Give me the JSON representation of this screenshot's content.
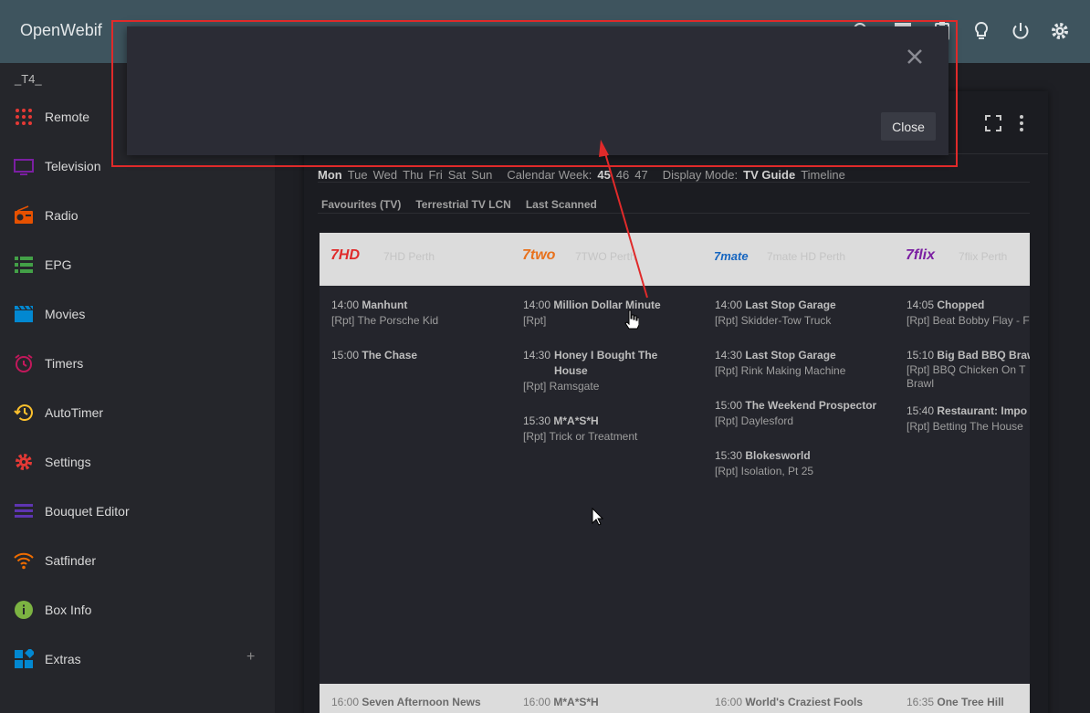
{
  "app": {
    "title": "OpenWebif"
  },
  "topbar": {
    "icons": [
      "search-icon",
      "grid-icon",
      "clipboard-icon",
      "lightbulb-icon",
      "power-icon",
      "gear-icon"
    ]
  },
  "sidebar": {
    "box_name": "_T4_",
    "items": [
      {
        "label": "Remote",
        "icon": "remote-icon",
        "color": "#e53935"
      },
      {
        "label": "Television",
        "icon": "tv-icon",
        "color": "#7b1fa2"
      },
      {
        "label": "Radio",
        "icon": "radio-icon",
        "color": "#e65100"
      },
      {
        "label": "EPG",
        "icon": "epg-icon",
        "color": "#43a047"
      },
      {
        "label": "Movies",
        "icon": "movies-icon",
        "color": "#0288d1"
      },
      {
        "label": "Timers",
        "icon": "alarm-icon",
        "color": "#c2185b"
      },
      {
        "label": "AutoTimer",
        "icon": "history-icon",
        "color": "#fbc02d"
      },
      {
        "label": "Settings",
        "icon": "gear-icon",
        "color": "#e53935"
      },
      {
        "label": "Bouquet Editor",
        "icon": "list-icon",
        "color": "#5e35b1"
      },
      {
        "label": "Satfinder",
        "icon": "wifi-icon",
        "color": "#ef6c00"
      },
      {
        "label": "Box Info",
        "icon": "info-icon",
        "color": "#7cb342"
      },
      {
        "label": "Extras",
        "icon": "dashboard-icon",
        "color": "#0288d1",
        "expand": "+"
      }
    ]
  },
  "epg": {
    "days": [
      "Mon",
      "Tue",
      "Wed",
      "Thu",
      "Fri",
      "Sat",
      "Sun"
    ],
    "calendar_week_label": "Calendar Week:",
    "weeks": [
      "45",
      "46",
      "47"
    ],
    "display_mode_label": "Display Mode:",
    "modes": [
      "TV Guide",
      "Timeline"
    ],
    "bouquets": [
      "Favourites (TV)",
      "Terrestrial TV LCN",
      "Last Scanned"
    ],
    "channels": [
      {
        "logo": "7HD",
        "name": "7HD Perth",
        "color": "#e02a2a",
        "programs": [
          {
            "time": "14:00",
            "title": "Manhunt",
            "sub": "[Rpt] The Porsche Kid"
          },
          {
            "time": "15:00",
            "title": "The Chase",
            "sub": ""
          }
        ]
      },
      {
        "logo": "7two",
        "name": "7TWO Perth",
        "color": "#e8711c",
        "programs": [
          {
            "time": "14:00",
            "title": "Million Dollar Minute",
            "sub": "[Rpt]"
          },
          {
            "time": "14:30",
            "title": "Honey I Bought The House",
            "sub": "[Rpt] Ramsgate"
          },
          {
            "time": "15:30",
            "title": "M*A*S*H",
            "sub": "[Rpt] Trick or Treatment"
          }
        ]
      },
      {
        "logo": "7mate",
        "name": "7mate HD Perth",
        "color": "#1565c0",
        "programs": [
          {
            "time": "14:00",
            "title": "Last Stop Garage",
            "sub": "[Rpt] Skidder-Tow Truck"
          },
          {
            "time": "14:30",
            "title": "Last Stop Garage",
            "sub": "[Rpt] Rink Making Machine"
          },
          {
            "time": "15:00",
            "title": "The Weekend Prospector",
            "sub": "[Rpt] Daylesford"
          },
          {
            "time": "15:30",
            "title": "Blokesworld",
            "sub": "[Rpt] Isolation, Pt 25"
          }
        ]
      },
      {
        "logo": "7flix",
        "name": "7flix Perth",
        "color": "#7b1fa2",
        "programs": [
          {
            "time": "14:05",
            "title": "Chopped",
            "sub": "[Rpt] Beat Bobby Flay - F"
          },
          {
            "time": "15:10",
            "title": "Big Bad BBQ Braw",
            "sub": "[Rpt] BBQ Chicken On T Brawl"
          },
          {
            "time": "15:40",
            "title": "Restaurant: Impo",
            "sub": "[Rpt] Betting The House"
          }
        ]
      }
    ],
    "next_row": [
      {
        "time": "16:00",
        "title": "Seven Afternoon News"
      },
      {
        "time": "16:00",
        "title": "M*A*S*H"
      },
      {
        "time": "16:00",
        "title": "World's Craziest Fools"
      },
      {
        "time": "16:35",
        "title": "One Tree Hill"
      }
    ]
  },
  "modal": {
    "close_label": "Close"
  }
}
